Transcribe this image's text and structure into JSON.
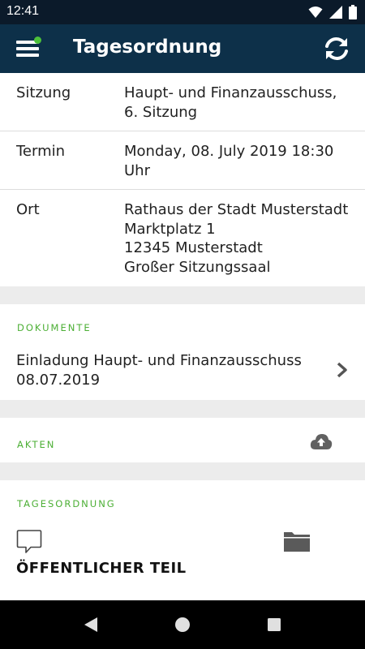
{
  "status_bar": {
    "time": "12:41",
    "icons": [
      "wifi-icon",
      "signal-icon",
      "battery-icon"
    ]
  },
  "app_bar": {
    "title": "Tagesordnung",
    "menu_icon": "hamburger-menu-icon",
    "refresh_icon": "refresh-icon",
    "notification_dot_color": "#4cc13a"
  },
  "details": [
    {
      "label": "Sitzung",
      "value": "Haupt- und Finanzausschuss, 6. Sitzung"
    },
    {
      "label": "Termin",
      "value": "Monday, 08. July 2019 18:30 Uhr"
    },
    {
      "label": "Ort",
      "value": "Rathaus der Stadt Musterstadt\nMarktplatz 1\n12345 Musterstadt\nGroßer Sitzungssaal"
    }
  ],
  "documents": {
    "header": "DOKUMENTE",
    "items": [
      {
        "title": "Einladung Haupt- und Finanzausschuss 08.07.2019",
        "icon": "chevron-right-icon"
      }
    ]
  },
  "akten": {
    "header": "AKTEN",
    "icon": "cloud-upload-icon"
  },
  "agenda": {
    "header": "TAGESORDNUNG",
    "comment_icon": "comment-icon",
    "folder_icon": "folder-icon",
    "section_title": "ÖFFENTLICHER TEIL"
  },
  "colors": {
    "app_bar": "#0d3049",
    "status_bar": "#0b1a2a",
    "accent_green": "#4caf35",
    "background": "#ececec"
  },
  "nav_bar": {
    "buttons": [
      "back-icon",
      "home-icon",
      "recents-icon"
    ]
  }
}
